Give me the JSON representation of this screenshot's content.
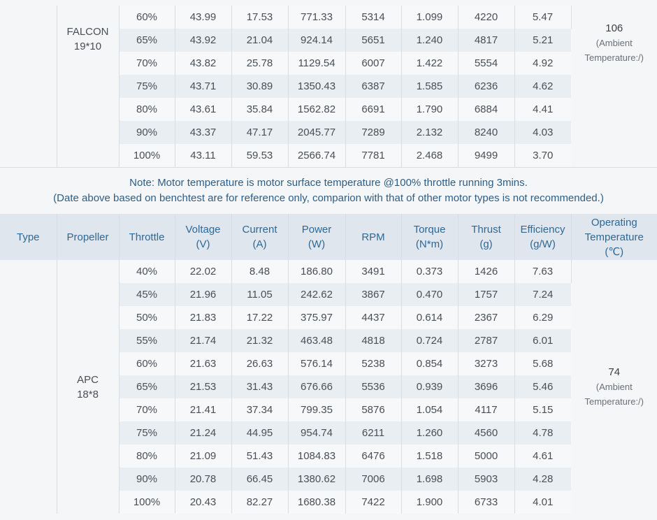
{
  "upper": {
    "propeller": [
      "FALCON",
      "19*10"
    ],
    "temperature": "106",
    "temp_note": [
      "(Ambient",
      "Temperature:/)"
    ],
    "rows": [
      [
        "60%",
        "43.99",
        "17.53",
        "771.33",
        "5314",
        "1.099",
        "4220",
        "5.47"
      ],
      [
        "65%",
        "43.92",
        "21.04",
        "924.14",
        "5651",
        "1.240",
        "4817",
        "5.21"
      ],
      [
        "70%",
        "43.82",
        "25.78",
        "1129.54",
        "6007",
        "1.422",
        "5554",
        "4.92"
      ],
      [
        "75%",
        "43.71",
        "30.89",
        "1350.43",
        "6387",
        "1.585",
        "6236",
        "4.62"
      ],
      [
        "80%",
        "43.61",
        "35.84",
        "1562.82",
        "6691",
        "1.790",
        "6884",
        "4.41"
      ],
      [
        "90%",
        "43.37",
        "47.17",
        "2045.77",
        "7289",
        "2.132",
        "8240",
        "4.03"
      ],
      [
        "100%",
        "43.11",
        "59.53",
        "2566.74",
        "7781",
        "2.468",
        "9499",
        "3.70"
      ]
    ]
  },
  "note": {
    "line1": "Note: Motor temperature is motor surface temperature @100% throttle running 3mins.",
    "line2": "(Date above based on benchtest are for reference only, comparion with that of other motor types is not recommended.)"
  },
  "header": {
    "type": "Type",
    "propeller": "Propeller",
    "throttle": "Throttle",
    "voltage": [
      "Voltage",
      "(V)"
    ],
    "current": [
      "Current",
      "(A)"
    ],
    "power": [
      "Power",
      "(W)"
    ],
    "rpm": "RPM",
    "torque": [
      "Torque",
      "(N*m)"
    ],
    "thrust": [
      "Thrust",
      "(g)"
    ],
    "efficiency": [
      "Efficiency",
      "(g/W)"
    ],
    "operating": [
      "Operating",
      "Temperature",
      "(℃)"
    ]
  },
  "lower": {
    "propeller": [
      "APC",
      "18*8"
    ],
    "temperature": "74",
    "temp_note": [
      "(Ambient",
      "Temperature:/)"
    ],
    "rows": [
      [
        "40%",
        "22.02",
        "8.48",
        "186.80",
        "3491",
        "0.373",
        "1426",
        "7.63"
      ],
      [
        "45%",
        "21.96",
        "11.05",
        "242.62",
        "3867",
        "0.470",
        "1757",
        "7.24"
      ],
      [
        "50%",
        "21.83",
        "17.22",
        "375.97",
        "4437",
        "0.614",
        "2367",
        "6.29"
      ],
      [
        "55%",
        "21.74",
        "21.32",
        "463.48",
        "4818",
        "0.724",
        "2787",
        "6.01"
      ],
      [
        "60%",
        "21.63",
        "26.63",
        "576.14",
        "5238",
        "0.854",
        "3273",
        "5.68"
      ],
      [
        "65%",
        "21.53",
        "31.43",
        "676.66",
        "5536",
        "0.939",
        "3696",
        "5.46"
      ],
      [
        "70%",
        "21.41",
        "37.34",
        "799.35",
        "5876",
        "1.054",
        "4117",
        "5.15"
      ],
      [
        "75%",
        "21.24",
        "44.95",
        "954.74",
        "6211",
        "1.260",
        "4560",
        "4.78"
      ],
      [
        "80%",
        "21.09",
        "51.43",
        "1084.83",
        "6476",
        "1.518",
        "5000",
        "4.61"
      ],
      [
        "90%",
        "20.78",
        "66.45",
        "1380.62",
        "7006",
        "1.698",
        "5903",
        "4.28"
      ],
      [
        "100%",
        "20.43",
        "82.27",
        "1680.38",
        "7422",
        "1.900",
        "6733",
        "4.01"
      ]
    ]
  }
}
